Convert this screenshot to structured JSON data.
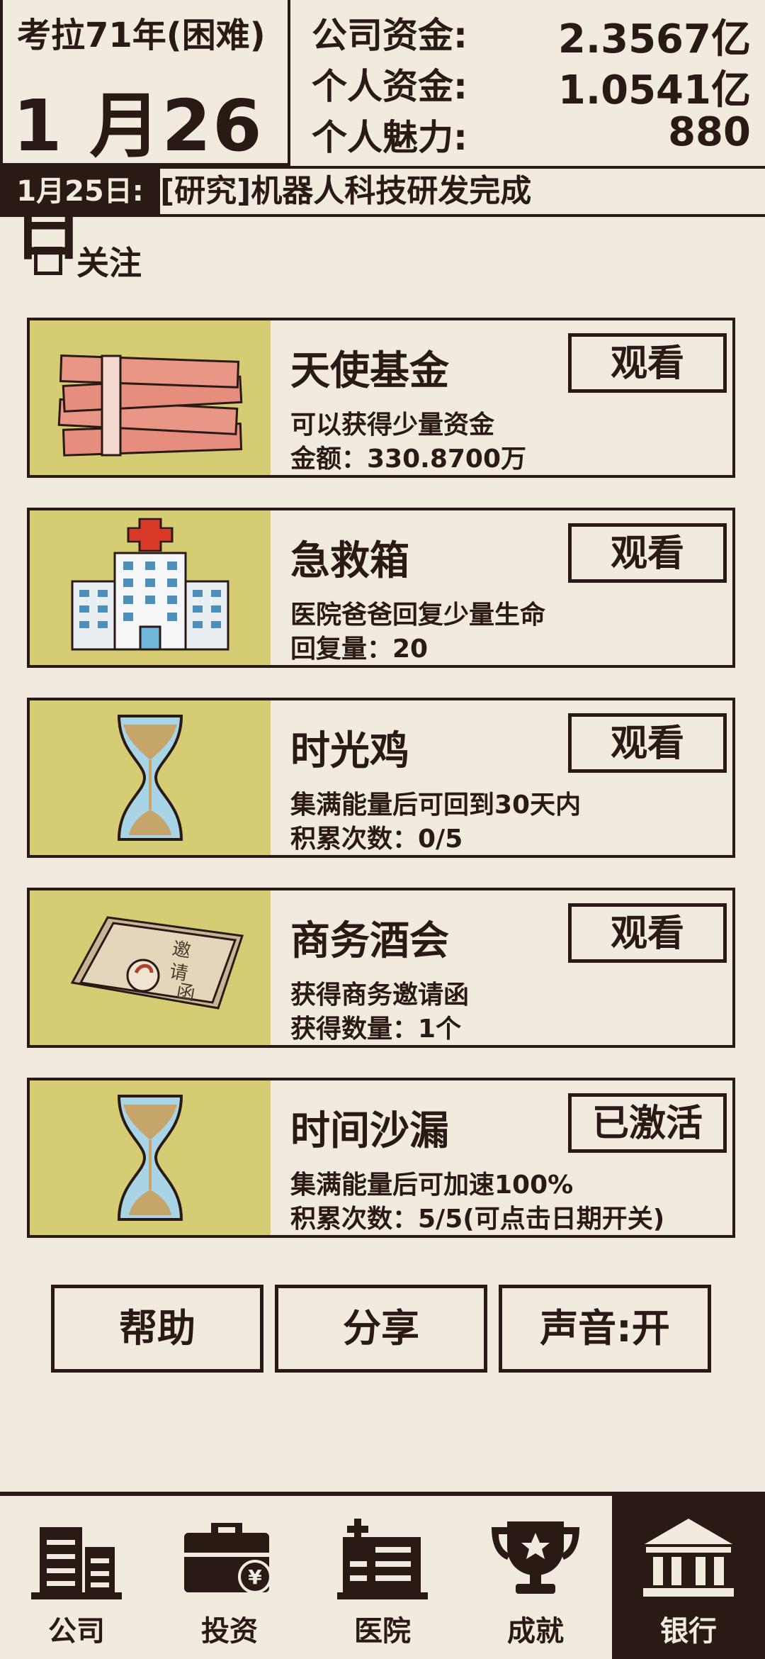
{
  "header": {
    "year_text": "考拉71年(困难)",
    "date_text": "1 月26 日",
    "stats": [
      {
        "key": "公司资金:",
        "value": "2.3567亿"
      },
      {
        "key": "个人资金:",
        "value": "1.0541亿"
      },
      {
        "key": "个人魅力:",
        "value": "880"
      }
    ]
  },
  "news": {
    "date": "1月25日:",
    "text": "[研究]机器人科技研发完成"
  },
  "follow": {
    "label": "关注",
    "checked": false
  },
  "cards": [
    {
      "title": "天使基金",
      "desc": "可以获得少量资金",
      "meta": "金额：330.8700万",
      "button": "观看",
      "icon": "money-stack-icon"
    },
    {
      "title": "急救箱",
      "desc": "医院爸爸回复少量生命",
      "meta": "回复量：20",
      "button": "观看",
      "icon": "hospital-icon"
    },
    {
      "title": "时光鸡",
      "desc": "集满能量后可回到30天内",
      "meta": "积累次数：0/5",
      "button": "观看",
      "icon": "hourglass-icon"
    },
    {
      "title": "商务酒会",
      "desc": "获得商务邀请函",
      "meta": "获得数量：1个",
      "button": "观看",
      "icon": "invitation-letter-icon"
    },
    {
      "title": "时间沙漏",
      "desc": "集满能量后可加速100%",
      "meta": "积累次数：5/5(可点击日期开关)",
      "button": "已激活",
      "icon": "hourglass-icon"
    }
  ],
  "actions": {
    "help": "帮助",
    "share": "分享",
    "sound": "声音:开"
  },
  "tabs": [
    {
      "label": "公司",
      "icon": "company-building-icon"
    },
    {
      "label": "投资",
      "icon": "briefcase-yen-icon"
    },
    {
      "label": "医院",
      "icon": "hospital-building-icon"
    },
    {
      "label": "成就",
      "icon": "trophy-icon"
    },
    {
      "label": "银行",
      "icon": "bank-icon",
      "active": true
    }
  ],
  "colors": {
    "ink": "#2a1a16",
    "paper": "#f1ebdf",
    "thumb_bg": "#d6cc74"
  }
}
